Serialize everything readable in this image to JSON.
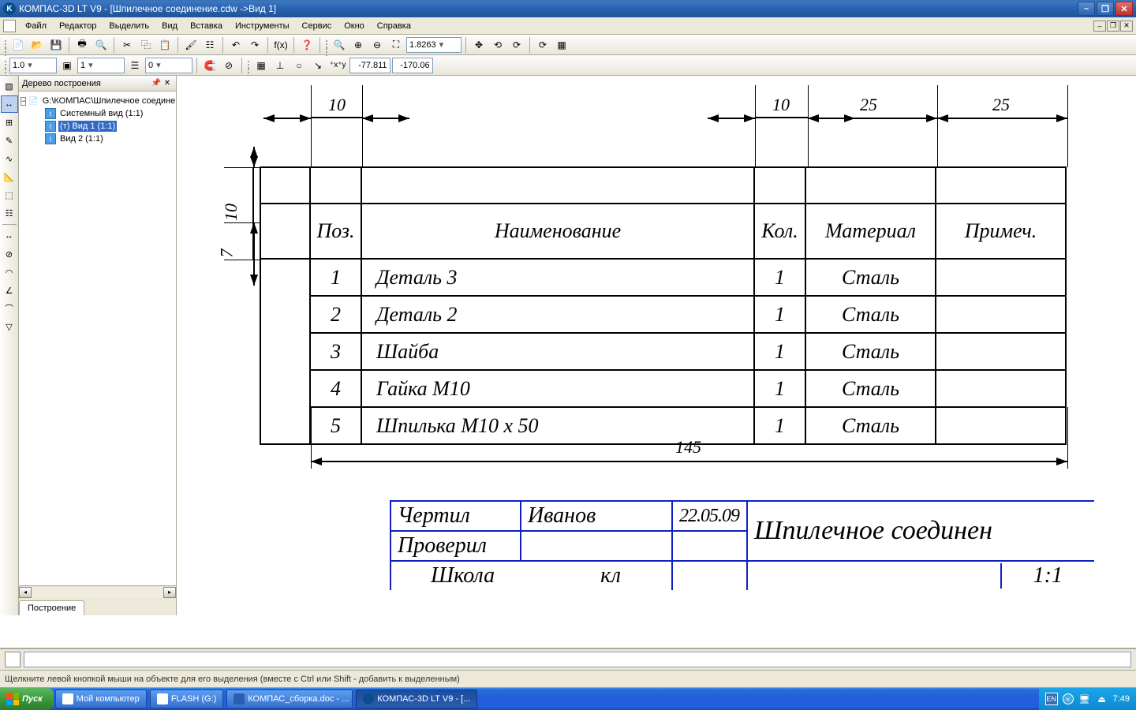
{
  "titlebar": {
    "app_icon_letter": "K",
    "title": "КОМПАС-3D LT V9 - [Шпилечное соединение.cdw ->Вид 1]"
  },
  "menu": {
    "items": [
      "Файл",
      "Редактор",
      "Выделить",
      "Вид",
      "Вставка",
      "Инструменты",
      "Сервис",
      "Окно",
      "Справка"
    ]
  },
  "toolbar1": {
    "zoom_value": "1.8263"
  },
  "toolbar2": {
    "style_value": "1.0",
    "layer1_value": "1",
    "layer2_value": "0",
    "coord_label": "⁺x⁺y",
    "coord_x": "-77.811",
    "coord_y": "-170.06"
  },
  "tree": {
    "title": "Дерево построения",
    "root": "G:\\КОМПАС\\Шпилечное соединен",
    "nodes": [
      {
        "label": "Системный вид (1:1)",
        "selected": false
      },
      {
        "label": "(т) Вид 1 (1:1)",
        "selected": true
      },
      {
        "label": "Вид 2 (1:1)",
        "selected": false
      }
    ],
    "tab": "Построение"
  },
  "drawing": {
    "dims": {
      "d10_left": "10",
      "d10_right": "10",
      "d25_a": "25",
      "d25_b": "25",
      "d10_v": "10",
      "d7_v": "7",
      "d145": "145"
    },
    "spec_headers": [
      "Поз.",
      "Наименование",
      "Кол.",
      "Материал",
      "Примеч."
    ],
    "spec_rows": [
      {
        "pos": "1",
        "name": "Деталь 3",
        "qty": "1",
        "mat": "Сталь",
        "note": ""
      },
      {
        "pos": "2",
        "name": "Деталь 2",
        "qty": "1",
        "mat": "Сталь",
        "note": ""
      },
      {
        "pos": "3",
        "name": "Шайба",
        "qty": "1",
        "mat": "Сталь",
        "note": ""
      },
      {
        "pos": "4",
        "name": "Гайка М10",
        "qty": "1",
        "mat": "Сталь",
        "note": ""
      },
      {
        "pos": "5",
        "name": "Шпилька М10 х 50",
        "qty": "1",
        "mat": "Сталь",
        "note": ""
      }
    ],
    "stamp": {
      "drew_label": "Чертил",
      "drew_name": "Иванов",
      "drew_date": "22.05.09",
      "checked_label": "Проверил",
      "title": "Шпилечное соединен",
      "school": "Школа",
      "class": "кл",
      "scale": "1:1"
    }
  },
  "status": {
    "hint": "Щелкните левой кнопкой мыши на объекте для его выделения (вместе c Ctrl или Shift - добавить к выделенным)"
  },
  "taskbar": {
    "start": "Пуск",
    "items": [
      {
        "label": "Мой компьютер",
        "active": false
      },
      {
        "label": "FLASH (G:)",
        "active": false
      },
      {
        "label": "КОМПАС_сборка.doc - ...",
        "active": false
      },
      {
        "label": "КОМПАС-3D LT V9 - [...",
        "active": true
      }
    ],
    "lang": "EN",
    "clock": "7:49"
  }
}
